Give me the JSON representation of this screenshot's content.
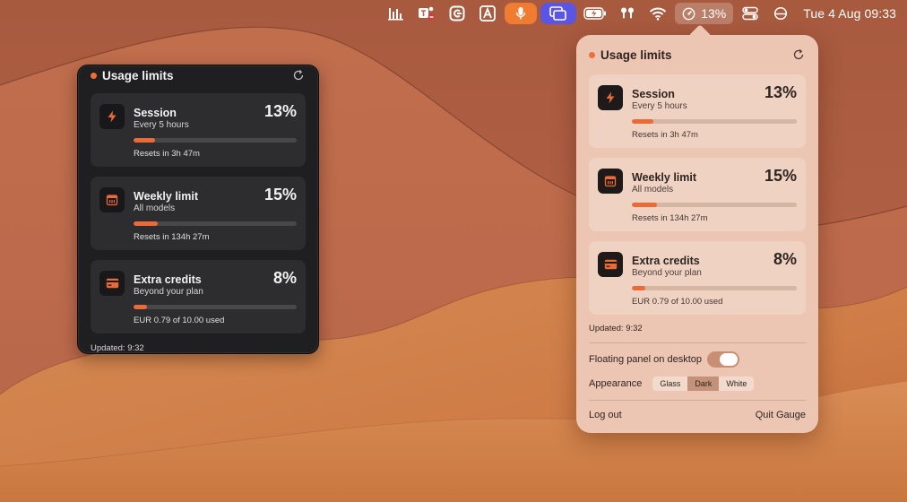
{
  "menubar": {
    "icons": [
      "equalizer-icon",
      "teams-icon",
      "clipboard-c-icon",
      "a-box-icon",
      "microphone-icon",
      "screens-icon",
      "battery-charging-icon",
      "airpods-icon",
      "wifi-icon",
      "gauge-icon",
      "control-center-icon",
      "focus-icon"
    ],
    "gauge_pct": "13%",
    "clock": "Tue 4 Aug  09:33",
    "mic_color": "#f07c32",
    "screens_color": "#5b55e6"
  },
  "floating_panel": {
    "title": "Usage limits",
    "updated": "Updated: 9:32",
    "cards": [
      {
        "icon": "bolt-icon",
        "title": "Session",
        "sub": "Every 5 hours",
        "pct": "13%",
        "fill": 0.13,
        "foot": "Resets in 3h 47m"
      },
      {
        "icon": "calendar-icon",
        "title": "Weekly limit",
        "sub": "All models",
        "pct": "15%",
        "fill": 0.15,
        "foot": "Resets in 134h 27m"
      },
      {
        "icon": "card-icon",
        "title": "Extra credits",
        "sub": "Beyond your plan",
        "pct": "8%",
        "fill": 0.08,
        "foot": "EUR 0.79 of 10.00 used"
      }
    ]
  },
  "popover": {
    "title": "Usage limits",
    "updated": "Updated: 9:32",
    "cards": [
      {
        "icon": "bolt-icon",
        "title": "Session",
        "sub": "Every 5 hours",
        "pct": "13%",
        "fill": 0.13,
        "foot": "Resets in 3h 47m"
      },
      {
        "icon": "calendar-icon",
        "title": "Weekly limit",
        "sub": "All models",
        "pct": "15%",
        "fill": 0.15,
        "foot": "Resets in 134h 27m"
      },
      {
        "icon": "card-icon",
        "title": "Extra credits",
        "sub": "Beyond your plan",
        "pct": "8%",
        "fill": 0.08,
        "foot": "EUR 0.79 of 10.00 used"
      }
    ],
    "floating_label": "Floating panel on desktop",
    "floating_on": true,
    "appearance_label": "Appearance",
    "appearance_options": [
      "Glass",
      "Dark",
      "White"
    ],
    "appearance_selected": "Dark",
    "logout": "Log out",
    "quit": "Quit Gauge"
  },
  "colors": {
    "accent": "#ea6a38",
    "desktop": "#c47a4f"
  }
}
